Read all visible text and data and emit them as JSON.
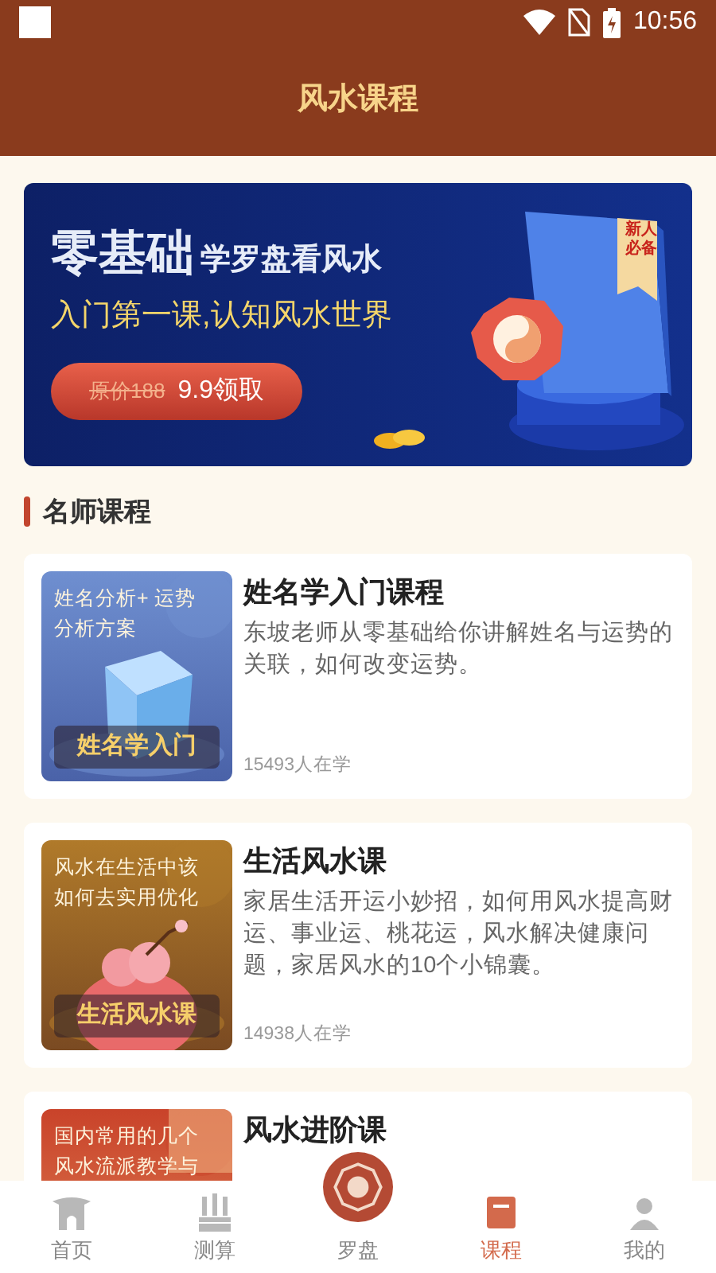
{
  "status_bar": {
    "time": "10:56"
  },
  "header": {
    "title": "风水课程"
  },
  "banner": {
    "headline_big": "零基础",
    "headline_small": "学罗盘看风水",
    "subtitle": "入门第一课,认知风水世界",
    "original_price": "原价188",
    "offer": "9.9领取",
    "ribbon": [
      "新人",
      "必备"
    ]
  },
  "section": {
    "title": "名师课程"
  },
  "courses": [
    {
      "title": "姓名学入门课程",
      "description": "东坡老师从零基础给你讲解姓名与运势的关联，如何改变运势。",
      "learners": "15493人在学",
      "cover_lines": [
        "姓名分析+ 运势",
        "分析方案"
      ],
      "cover_label": "姓名学入门",
      "kind": "blue"
    },
    {
      "title": "生活风水课",
      "description": "家居生活开运小妙招，如何用风水提高财运、事业运、桃花运，风水解决健康问题，家居风水的10个小锦囊。",
      "learners": "14938人在学",
      "cover_lines": [
        "风水在生活中该",
        "如何去实用优化"
      ],
      "cover_label": "生活风水课",
      "kind": "brown"
    },
    {
      "title": "风水进阶课",
      "cover_lines": [
        "国内常用的几个",
        "风水流派教学与"
      ],
      "kind": "red"
    }
  ],
  "tab_bar": {
    "items": [
      {
        "label": "首页",
        "kind": "home",
        "selected": false
      },
      {
        "label": "测算",
        "kind": "calc",
        "selected": false
      },
      {
        "label": "罗盘",
        "kind": "compass",
        "selected": false
      },
      {
        "label": "课程",
        "kind": "course",
        "selected": true
      },
      {
        "label": "我的",
        "kind": "me",
        "selected": false
      }
    ]
  }
}
